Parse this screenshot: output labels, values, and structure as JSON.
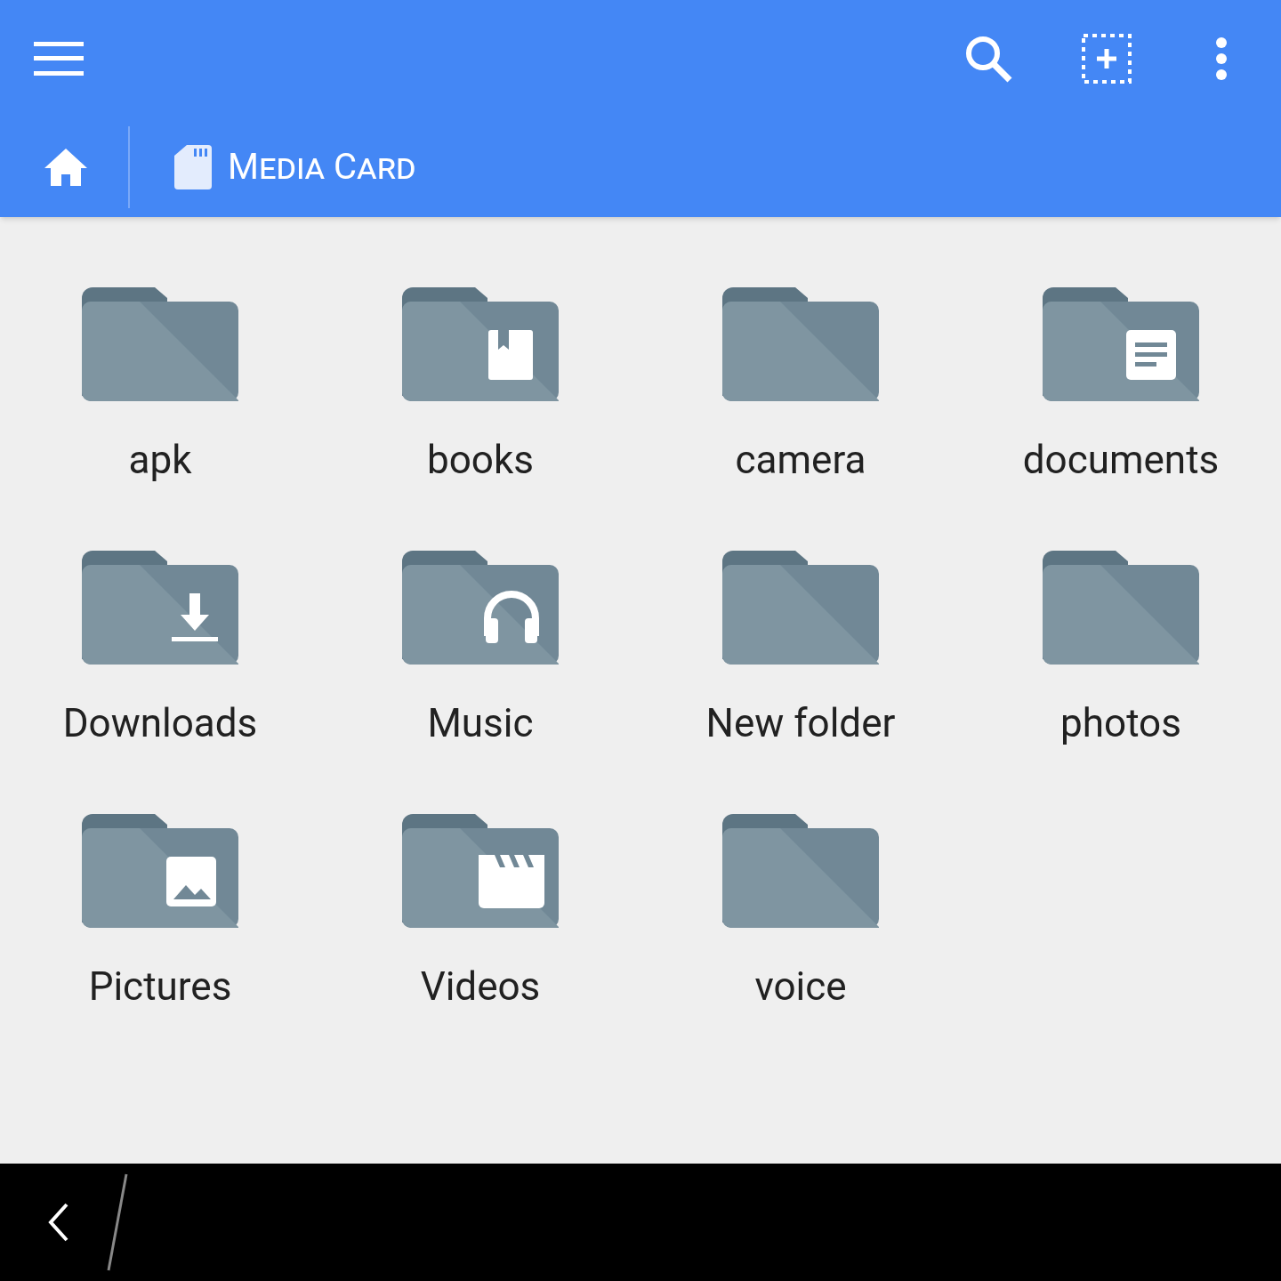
{
  "breadcrumb": {
    "label": "Media Card"
  },
  "folders": [
    {
      "name": "apk",
      "kind": "plain"
    },
    {
      "name": "books",
      "kind": "book"
    },
    {
      "name": "camera",
      "kind": "plain"
    },
    {
      "name": "documents",
      "kind": "document"
    },
    {
      "name": "Downloads",
      "kind": "download"
    },
    {
      "name": "Music",
      "kind": "headphones"
    },
    {
      "name": "New folder",
      "kind": "plain"
    },
    {
      "name": "photos",
      "kind": "plain"
    },
    {
      "name": "Pictures",
      "kind": "picture"
    },
    {
      "name": "Videos",
      "kind": "video"
    },
    {
      "name": "voice",
      "kind": "plain"
    }
  ]
}
